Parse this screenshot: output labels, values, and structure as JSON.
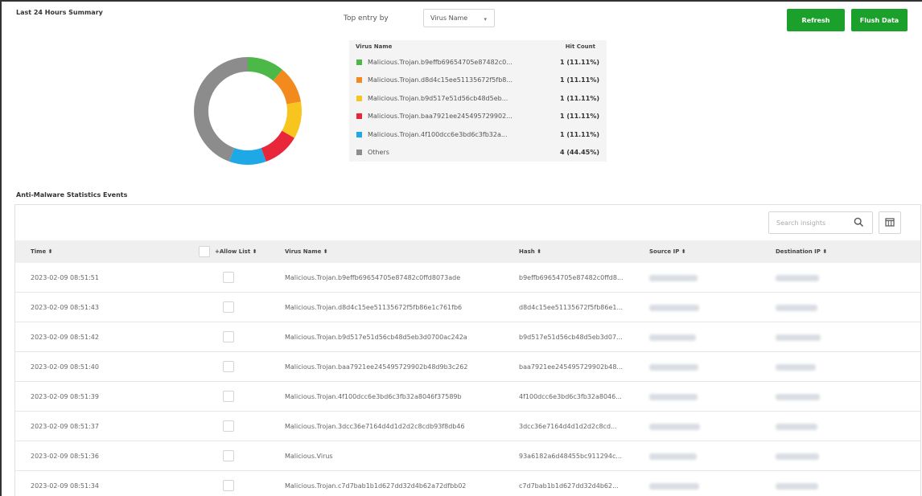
{
  "summary": {
    "title": "Last 24 Hours Summary",
    "top_entry_label": "Top entry by",
    "top_entry_value": "Virus Name",
    "refresh_label": "Refresh",
    "flush_label": "Flush Data",
    "legend_header": {
      "name": "Virus Name",
      "count": "Hit Count"
    },
    "legend": [
      {
        "name": "Malicious.Trojan.b9effb69654705e87482c0...",
        "count": "1 (11.11%)",
        "color": "#4cb848",
        "fraction": 0.1111
      },
      {
        "name": "Malicious.Trojan.d8d4c15ee51135672f5fb8...",
        "count": "1 (11.11%)",
        "color": "#f28a1e",
        "fraction": 0.1111
      },
      {
        "name": "Malicious.Trojan.b9d517e51d56cb48d5eb...",
        "count": "1 (11.11%)",
        "color": "#f7c51e",
        "fraction": 0.1111
      },
      {
        "name": "Malicious.Trojan.baa7921ee245495729902...",
        "count": "1 (11.11%)",
        "color": "#e8273a",
        "fraction": 0.1111
      },
      {
        "name": "Malicious.Trojan.4f100dcc6e3bd6c3fb32a...",
        "count": "1 (11.11%)",
        "color": "#1ea9e6",
        "fraction": 0.1111
      },
      {
        "name": "Others",
        "count": "4 (44.45%)",
        "color": "#8c8c8c",
        "fraction": 0.4445
      }
    ]
  },
  "events": {
    "title": "Anti-Malware Statistics Events",
    "search_placeholder": "Search insights",
    "columns": {
      "time": "Time ⬍",
      "allow": "+Allow List ⬍",
      "virus": "Virus Name ⬍",
      "hash": "Hash ⬍",
      "source": "Source IP ⬍",
      "dest": "Destination IP ⬍"
    },
    "rows": [
      {
        "time": "2023-02-09 08:51:51",
        "virus": "Malicious.Trojan.b9effb69654705e87482c0ffd8073ade",
        "hash": "b9effb69654705e87482c0ffd8..."
      },
      {
        "time": "2023-02-09 08:51:43",
        "virus": "Malicious.Trojan.d8d4c15ee51135672f5fb86e1c761fb6",
        "hash": "d8d4c15ee51135672f5fb86e1..."
      },
      {
        "time": "2023-02-09 08:51:42",
        "virus": "Malicious.Trojan.b9d517e51d56cb48d5eb3d0700ac242a",
        "hash": "b9d517e51d56cb48d5eb3d07..."
      },
      {
        "time": "2023-02-09 08:51:40",
        "virus": "Malicious.Trojan.baa7921ee245495729902b48d9b3c262",
        "hash": "baa7921ee245495729902b48..."
      },
      {
        "time": "2023-02-09 08:51:39",
        "virus": "Malicious.Trojan.4f100dcc6e3bd6c3fb32a8046f37589b",
        "hash": "4f100dcc6e3bd6c3fb32a8046..."
      },
      {
        "time": "2023-02-09 08:51:37",
        "virus": "Malicious.Trojan.3dcc36e7164d4d1d2d2c8cdb93f8db46",
        "hash": "3dcc36e7164d4d1d2d2c8cd..."
      },
      {
        "time": "2023-02-09 08:51:36",
        "virus": "Malicious.Virus",
        "hash": "93a6182a6d48455bc911294c..."
      },
      {
        "time": "2023-02-09 08:51:34",
        "virus": "Malicious.Trojan.c7d7bab1b1d627dd32d4b62a72dfbb02",
        "hash": "c7d7bab1b1d627dd32d4b62..."
      }
    ]
  },
  "colors": {
    "accent": "#1ba02c"
  },
  "icons": {
    "search": "search-icon",
    "columns": "columns-icon",
    "caret": "chevron-down-icon"
  }
}
